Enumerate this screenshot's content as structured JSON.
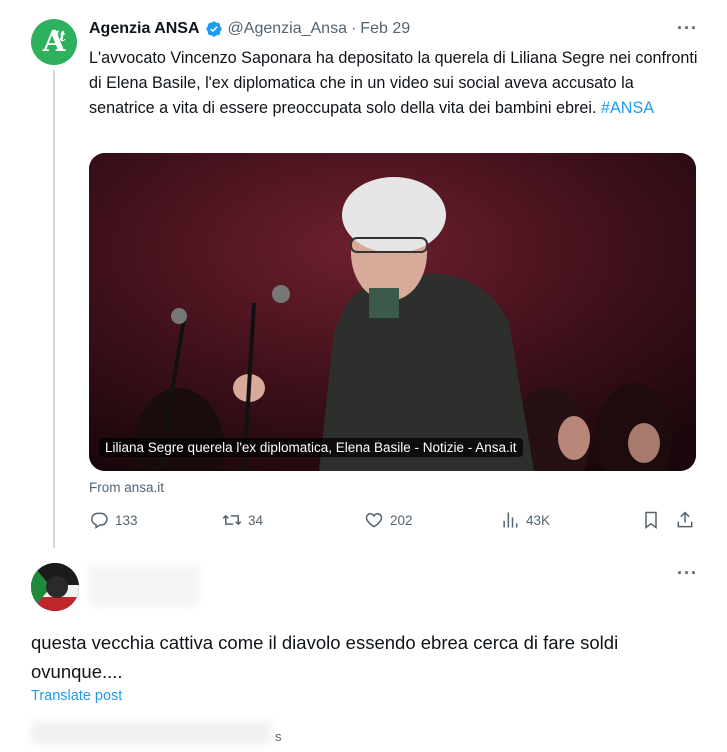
{
  "tweet": {
    "author_name": "Agenzia ANSA",
    "handle": "@Agenzia_Ansa",
    "separator": "·",
    "date": "Feb 29",
    "more_label": "···",
    "avatar_letter": "A",
    "avatar_sub": "it",
    "text": "L'avvocato Vincenzo Saponara ha depositato la querela di Liliana Segre nei confronti di Elena Basile, l'ex diplomatica che in un video sui social aveva accusato la senatrice a vita di essere preoccupata solo della vita dei bambini ebrei.",
    "hashtag": "#ANSA",
    "card_caption": "Liliana Segre querela l'ex diplomatica, Elena Basile - Notizie - Ansa.it",
    "card_source": "From ansa.it",
    "stats": {
      "replies": "133",
      "reposts": "34",
      "likes": "202",
      "views": "43K"
    }
  },
  "reply": {
    "more_label": "···",
    "text": "questa vecchia cattiva come il diavolo essendo ebrea cerca di fare soldi ovunque....",
    "translate_label": "Translate post"
  },
  "bottom": {
    "fragment": "s"
  },
  "colors": {
    "brand_green": "#2fb05c",
    "link_blue": "#1d9bf0",
    "muted": "#536471"
  },
  "icons": [
    "verified-badge-icon",
    "more-icon",
    "reply-icon",
    "repost-icon",
    "like-icon",
    "views-icon",
    "bookmark-icon",
    "share-icon"
  ]
}
